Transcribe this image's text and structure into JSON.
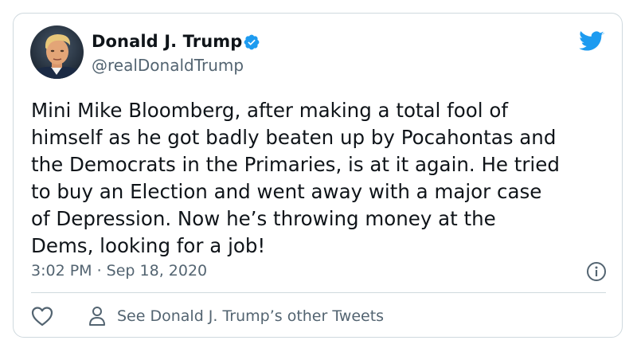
{
  "author": {
    "display_name": "Donald J. Trump",
    "handle": "@realDonaldTrump",
    "verified": true,
    "verified_icon": "verified-badge-icon"
  },
  "tweet": {
    "text": "Mini Mike Bloomberg, after making a total fool of\nhimself as he got badly beaten up by Pocahontas and\nthe Democrats in the Primaries, is at it again. He tried\nto buy an Election and went away with a major case\nof Depression. Now he’s throwing money at the\nDems, looking for a job!",
    "timestamp": "3:02 PM · Sep 18, 2020"
  },
  "actions": {
    "like_icon": "heart-icon",
    "other_tweets_icon": "person-icon",
    "other_tweets_label": "See Donald J. Trump’s other Tweets",
    "info_icon": "info-icon"
  },
  "branding": {
    "logo_icon": "twitter-bird-icon",
    "accent_color": "#1d9bf0",
    "secondary_text_color": "#536471",
    "border_color": "#cfd9de"
  }
}
